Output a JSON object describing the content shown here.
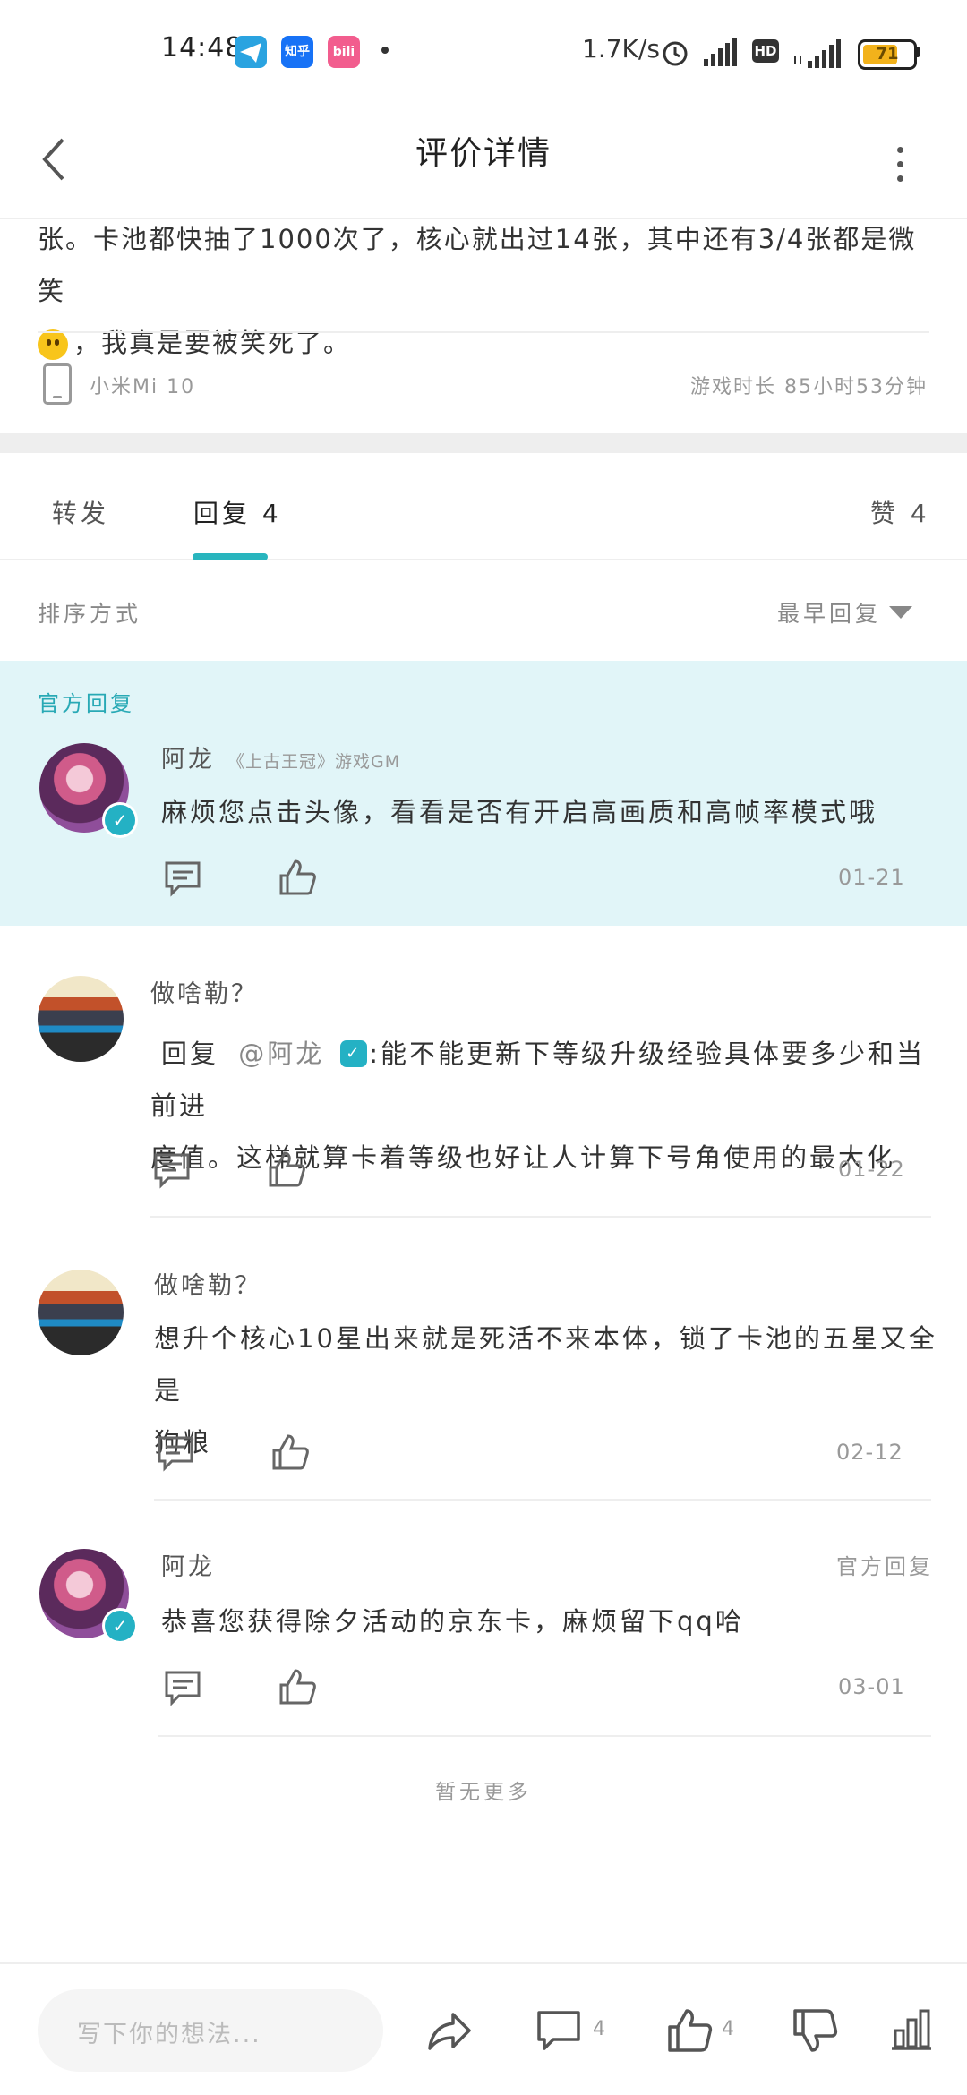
{
  "status_bar": {
    "time": "14:48",
    "apps": [
      {
        "name": "telegram-icon",
        "color": "#2aa3e0",
        "text": ""
      },
      {
        "name": "zhihu-icon",
        "color": "#1772f6",
        "text": "知乎"
      },
      {
        "name": "bilibili-icon",
        "color": "#f25d8e",
        "text": "bili"
      }
    ],
    "network_speed": "1.7K/s",
    "battery_level": "71"
  },
  "header": {
    "title": "评价详情"
  },
  "review": {
    "text_line1": "张。卡池都快抽了1000次了，核心就出过14张，其中还有3/4张都是微笑",
    "text_line2": "，我真是要被笑死了。",
    "device": "小米Mi 10",
    "play_time": "游戏时长 85小时53分钟"
  },
  "tabs": [
    {
      "label": "转发"
    },
    {
      "label": "回复 4"
    },
    {
      "label": "赞 4"
    }
  ],
  "sort": {
    "label": "排序方式",
    "value": "最早回复"
  },
  "official_section_label": "官方回复",
  "replies": [
    {
      "name": "阿龙",
      "meta": "《上古王冠》游戏GM",
      "text": "麻烦您点击头像，看看是否有开启高画质和高帧率模式哦",
      "date": "01-21"
    },
    {
      "name": "做啥勒？",
      "reply_prefix": "回复",
      "mention": "@阿龙",
      "text_line1": ":能不能更新下等级升级经验具体要多少和当前进",
      "text_line2": "度值。这样就算卡着等级也好让人计算下号角使用的最大化",
      "date": "01-22"
    },
    {
      "name": "做啥勒？",
      "text_line1": "想升个核心10星出来就是死活不来本体，锁了卡池的五星又全是",
      "text_line2": "狗粮",
      "date": "02-12"
    },
    {
      "name": "阿龙",
      "tag": "官方回复",
      "text": "恭喜您获得除夕活动的京东卡，麻烦留下qq哈",
      "date": "03-01"
    }
  ],
  "no_more": "暂无更多",
  "bottom_bar": {
    "input_placeholder": "写下你的想法...",
    "comment_count": "4",
    "like_count": "4"
  },
  "colors": {
    "accent": "#28b5be",
    "official_bg": "#e1f5f8"
  }
}
